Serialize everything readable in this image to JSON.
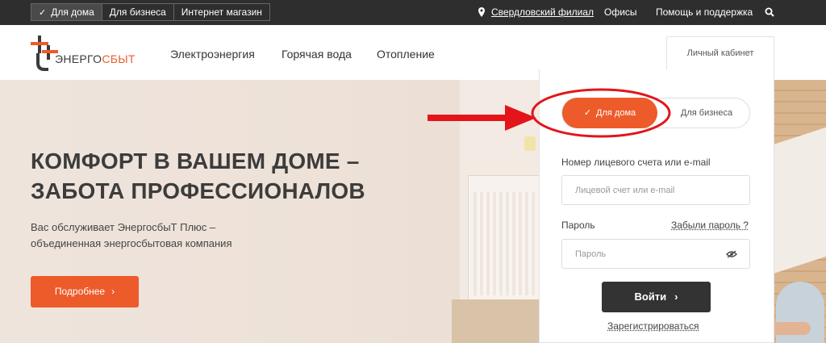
{
  "topbar": {
    "segments": [
      {
        "label": "Для дома",
        "active": true
      },
      {
        "label": "Для бизнеса",
        "active": false
      },
      {
        "label": "Интернет магазин",
        "active": false
      }
    ],
    "branch": "Свердловский филиал",
    "offices": "Офисы",
    "help": "Помощь и поддержка"
  },
  "header": {
    "logo_part1": "ЭНЕРГО",
    "logo_part2": "СБЫТ",
    "nav": [
      "Электроэнергия",
      "Горячая вода",
      "Отопление"
    ],
    "cabinet_tab": "Личный кабинет"
  },
  "hero": {
    "title": "КОМФОРТ В ВАШЕМ ДОМЕ – ЗАБОТА ПРОФЕССИОНАЛОВ",
    "subtitle": "Вас обслуживает ЭнергосбыТ Плюс – объединенная энергосбытовая компания",
    "more_button": "Подробнее"
  },
  "login": {
    "toggle_home": "Для дома",
    "toggle_business": "Для бизнеса",
    "account_label": "Номер лицевого счета или e-mail",
    "account_placeholder": "Лицевой счет или e-mail",
    "password_label": "Пароль",
    "forgot": "Забыли пароль ?",
    "password_placeholder": "Пароль",
    "login_button": "Войти",
    "register": "Зарегистрироваться"
  },
  "colors": {
    "accent": "#ed5b2a",
    "topbar": "#2e2e2e",
    "annotation_red": "#e3151a",
    "dark_button": "#333333"
  },
  "icons": [
    "check-icon",
    "location-pin-icon",
    "search-icon",
    "chevron-right-icon",
    "eye-icon",
    "logo-icon"
  ]
}
